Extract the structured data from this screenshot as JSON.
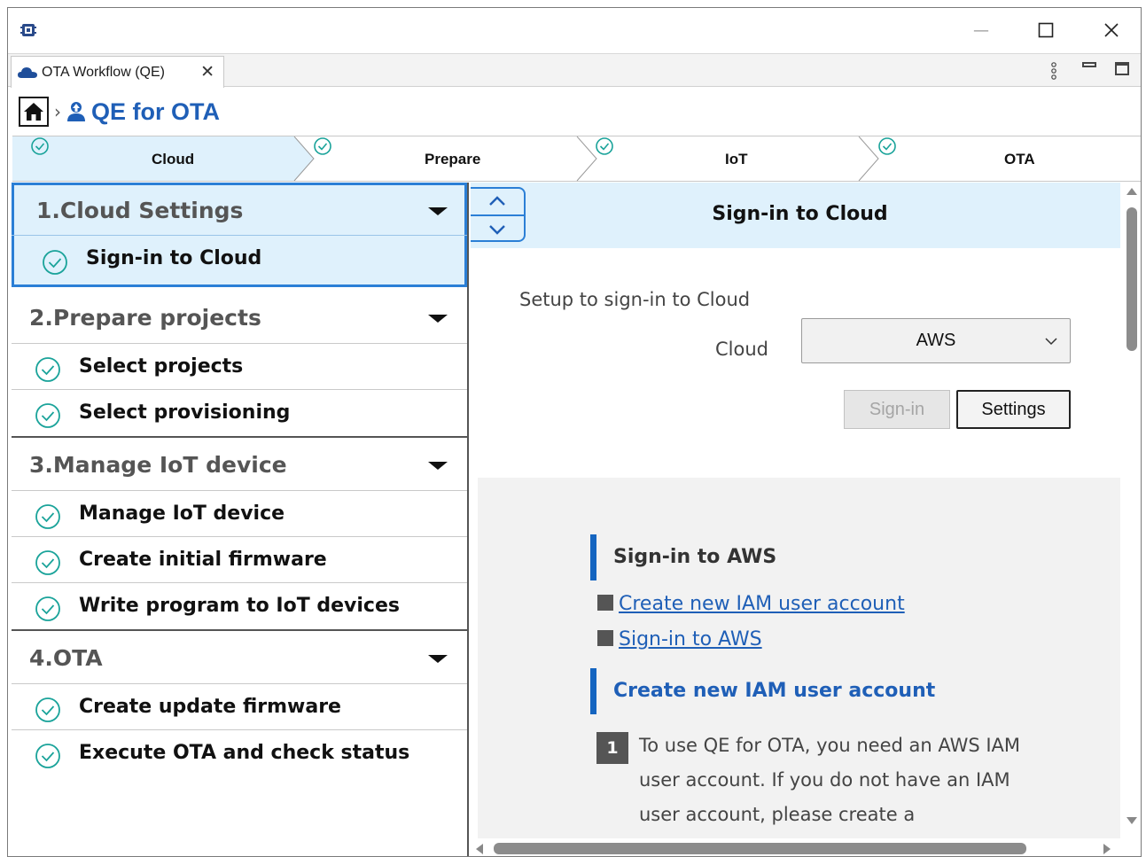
{
  "window": {
    "tab_title": "OTA Workflow (QE)",
    "icons": {
      "app": "chip-icon",
      "minimize": "minimize-icon",
      "maximize": "maximize-icon",
      "close": "close-icon",
      "tab_close": "tab-close-icon",
      "view_menu": "view-menu-icon"
    }
  },
  "breadcrumb": {
    "separator": "›",
    "title": "QE for OTA"
  },
  "steps": [
    {
      "label": "Cloud",
      "active": true
    },
    {
      "label": "Prepare",
      "active": false
    },
    {
      "label": "IoT",
      "active": false
    },
    {
      "label": "OTA",
      "active": false
    }
  ],
  "nav": {
    "sections": [
      {
        "title": "1.Cloud Settings",
        "items": [
          "Sign-in to Cloud"
        ]
      },
      {
        "title": "2.Prepare projects",
        "items": [
          "Select projects",
          "Select provisioning"
        ]
      },
      {
        "title": "3.Manage IoT device",
        "items": [
          "Manage IoT device",
          "Create initial firmware",
          "Write program to IoT devices"
        ]
      },
      {
        "title": "4.OTA",
        "items": [
          "Create update firmware",
          "Execute OTA and check status"
        ]
      }
    ]
  },
  "content": {
    "title": "Sign-in to Cloud",
    "setup_text": "Setup to sign-in to Cloud",
    "cloud_label": "Cloud",
    "cloud_value": "AWS",
    "signin_label": "Sign-in",
    "settings_label": "Settings"
  },
  "help": {
    "heading1": "Sign-in to AWS",
    "link1": "Create new IAM user account",
    "link2": "Sign-in to AWS",
    "heading2": "Create new IAM user account",
    "step1_number": "1",
    "step1_text": "To use QE for OTA, you need an AWS IAM user account. If you do not have an IAM user account, please create a"
  },
  "colors": {
    "accent": "#2b7fd6",
    "link": "#1f5fb7",
    "selected_bg": "#dff1fc",
    "check": "#1aa39a"
  }
}
